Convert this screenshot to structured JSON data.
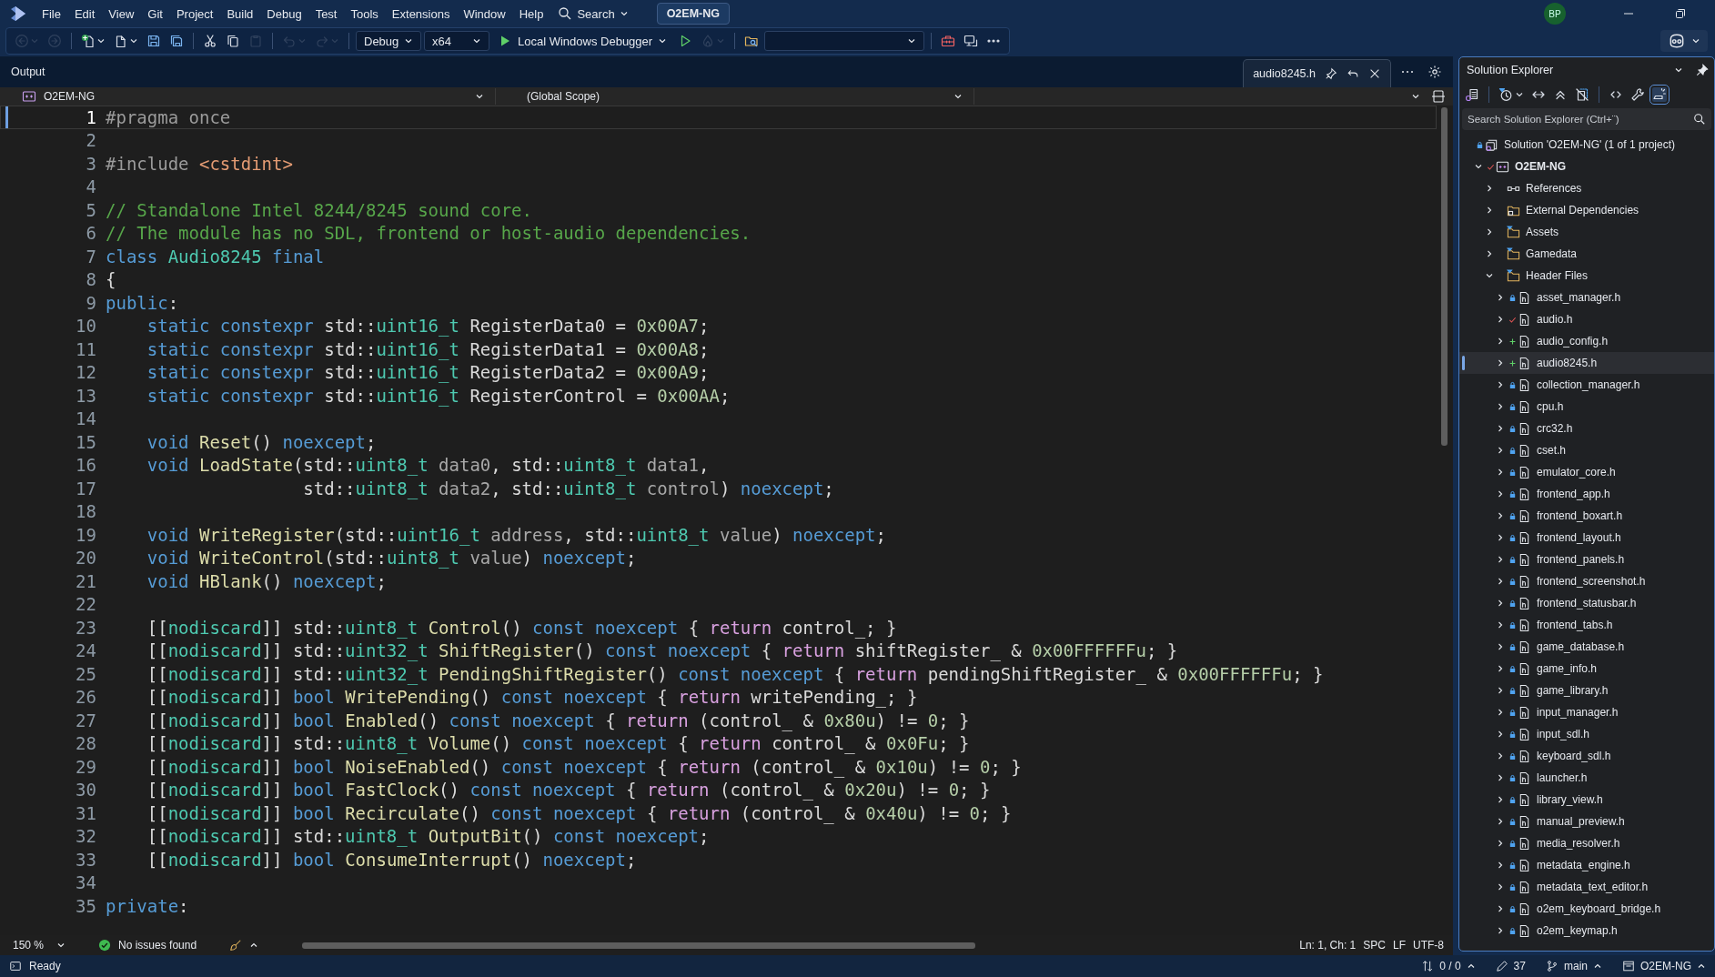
{
  "menu": [
    "File",
    "Edit",
    "View",
    "Git",
    "Project",
    "Build",
    "Debug",
    "Test",
    "Tools",
    "Extensions",
    "Window",
    "Help"
  ],
  "search": {
    "label": "Search"
  },
  "solution_badge": "O2EM-NG",
  "account": {
    "initials": "BP"
  },
  "toolbar": {
    "items": [
      {
        "kind": "back",
        "disabled": true,
        "dropdown": true
      },
      {
        "kind": "forward",
        "disabled": true,
        "dropdown": false
      },
      {
        "kind": "separator"
      },
      {
        "kind": "new_item",
        "disabled": false,
        "dropdown": true
      },
      {
        "kind": "open",
        "disabled": false,
        "dropdown": true
      },
      {
        "kind": "save",
        "disabled": false,
        "dropdown": false
      },
      {
        "kind": "save_all",
        "disabled": false,
        "dropdown": false
      },
      {
        "kind": "separator"
      },
      {
        "kind": "cut",
        "disabled": false,
        "dropdown": false
      },
      {
        "kind": "copy",
        "disabled": false,
        "dropdown": false
      },
      {
        "kind": "paste",
        "disabled": true,
        "dropdown": false
      },
      {
        "kind": "separator"
      },
      {
        "kind": "undo",
        "disabled": true,
        "dropdown": true
      },
      {
        "kind": "redo",
        "disabled": true,
        "dropdown": true
      },
      {
        "kind": "separator"
      },
      {
        "kind": "combo",
        "value": "Debug"
      },
      {
        "kind": "combo",
        "value": "x64"
      },
      {
        "kind": "debug_target",
        "label": "Local Windows Debugger"
      },
      {
        "kind": "start",
        "disabled": false,
        "dropdown": false
      },
      {
        "kind": "hot_reload",
        "disabled": true,
        "dropdown": true
      },
      {
        "kind": "separator"
      },
      {
        "kind": "find_in_files",
        "disabled": false,
        "dropdown": false
      },
      {
        "kind": "combo"
      },
      {
        "kind": "separator"
      },
      {
        "kind": "toolbox",
        "disabled": false,
        "dropdown": false
      },
      {
        "kind": "remote",
        "disabled": false,
        "dropdown": false
      },
      {
        "kind": "more",
        "disabled": false,
        "dropdown": false
      }
    ]
  },
  "document_well": {
    "tool_window": "Output",
    "tabs": [
      {
        "label": "audio8245.h",
        "selected": true
      }
    ]
  },
  "navigation_bar": {
    "project": "O2EM-NG",
    "scope": "(Global Scope)"
  },
  "editor": {
    "lines": [
      {
        "number": "1",
        "current": true,
        "tokens": [
          {
            "kind": "directive",
            "text": "#pragma once"
          }
        ]
      },
      {
        "number": "2",
        "current": false
      },
      {
        "number": "3",
        "current": false,
        "tokens": [
          {
            "kind": "directive",
            "text": "#include "
          },
          {
            "kind": "header",
            "text": "<cstdint>"
          }
        ]
      },
      {
        "number": "4",
        "current": false
      },
      {
        "number": "5",
        "current": false,
        "tokens": [
          {
            "kind": "comment",
            "text": "// Standalone Intel 8244/8245 sound core."
          }
        ]
      },
      {
        "number": "6",
        "current": false,
        "tokens": [
          {
            "kind": "comment",
            "text": "// The module has no SDL, frontend or host-audio dependencies."
          }
        ]
      },
      {
        "number": "7",
        "current": false,
        "tokens": [
          {
            "kind": "keyword",
            "text": "class "
          },
          {
            "kind": "type",
            "text": "Audio8245 "
          },
          {
            "kind": "keyword",
            "text": "final"
          }
        ]
      },
      {
        "number": "8",
        "current": false,
        "tokens": [
          {
            "kind": "plain",
            "text": "{"
          }
        ]
      },
      {
        "number": "9",
        "current": false,
        "tokens": [
          {
            "kind": "keyword",
            "text": "public"
          },
          {
            "kind": "plain",
            "text": ":"
          }
        ]
      },
      {
        "number": "10",
        "current": false,
        "tokens": [
          {
            "kind": "keyword",
            "text": "    static constexpr "
          },
          {
            "kind": "plain",
            "text": "std::"
          },
          {
            "kind": "type",
            "text": "uint16_t"
          },
          {
            "kind": "plain",
            "text": " RegisterData0 = "
          },
          {
            "kind": "number",
            "text": "0x00A7"
          },
          {
            "kind": "plain",
            "text": ";"
          }
        ]
      },
      {
        "number": "11",
        "current": false,
        "tokens": [
          {
            "kind": "keyword",
            "text": "    static constexpr "
          },
          {
            "kind": "plain",
            "text": "std::"
          },
          {
            "kind": "type",
            "text": "uint16_t"
          },
          {
            "kind": "plain",
            "text": " RegisterData1 = "
          },
          {
            "kind": "number",
            "text": "0x00A8"
          },
          {
            "kind": "plain",
            "text": ";"
          }
        ]
      },
      {
        "number": "12",
        "current": false,
        "tokens": [
          {
            "kind": "keyword",
            "text": "    static constexpr "
          },
          {
            "kind": "plain",
            "text": "std::"
          },
          {
            "kind": "type",
            "text": "uint16_t"
          },
          {
            "kind": "plain",
            "text": " RegisterData2 = "
          },
          {
            "kind": "number",
            "text": "0x00A9"
          },
          {
            "kind": "plain",
            "text": ";"
          }
        ]
      },
      {
        "number": "13",
        "current": false,
        "tokens": [
          {
            "kind": "keyword",
            "text": "    static constexpr "
          },
          {
            "kind": "plain",
            "text": "std::"
          },
          {
            "kind": "type",
            "text": "uint16_t"
          },
          {
            "kind": "plain",
            "text": " RegisterControl = "
          },
          {
            "kind": "number",
            "text": "0x00AA"
          },
          {
            "kind": "plain",
            "text": ";"
          }
        ]
      },
      {
        "number": "14",
        "current": false
      },
      {
        "number": "15",
        "current": false,
        "tokens": [
          {
            "kind": "keyword",
            "text": "    void "
          },
          {
            "kind": "function",
            "text": "Reset"
          },
          {
            "kind": "plain",
            "text": "() "
          },
          {
            "kind": "keyword",
            "text": "noexcept"
          },
          {
            "kind": "plain",
            "text": ";"
          }
        ]
      },
      {
        "number": "16",
        "current": false,
        "tokens": [
          {
            "kind": "keyword",
            "text": "    void "
          },
          {
            "kind": "function",
            "text": "LoadState"
          },
          {
            "kind": "plain",
            "text": "(std::"
          },
          {
            "kind": "type",
            "text": "uint8_t "
          },
          {
            "kind": "param",
            "text": "data0"
          },
          {
            "kind": "plain",
            "text": ", std::"
          },
          {
            "kind": "type",
            "text": "uint8_t "
          },
          {
            "kind": "param",
            "text": "data1"
          },
          {
            "kind": "plain",
            "text": ","
          }
        ]
      },
      {
        "number": "17",
        "current": false,
        "tokens": [
          {
            "kind": "plain",
            "text": "                   std::"
          },
          {
            "kind": "type",
            "text": "uint8_t "
          },
          {
            "kind": "param",
            "text": "data2"
          },
          {
            "kind": "plain",
            "text": ", std::"
          },
          {
            "kind": "type",
            "text": "uint8_t "
          },
          {
            "kind": "param",
            "text": "control"
          },
          {
            "kind": "plain",
            "text": ") "
          },
          {
            "kind": "keyword",
            "text": "noexcept"
          },
          {
            "kind": "plain",
            "text": ";"
          }
        ]
      },
      {
        "number": "18",
        "current": false
      },
      {
        "number": "19",
        "current": false,
        "tokens": [
          {
            "kind": "keyword",
            "text": "    void "
          },
          {
            "kind": "function",
            "text": "WriteRegister"
          },
          {
            "kind": "plain",
            "text": "(std::"
          },
          {
            "kind": "type",
            "text": "uint16_t "
          },
          {
            "kind": "param",
            "text": "address"
          },
          {
            "kind": "plain",
            "text": ", std::"
          },
          {
            "kind": "type",
            "text": "uint8_t "
          },
          {
            "kind": "param",
            "text": "value"
          },
          {
            "kind": "plain",
            "text": ") "
          },
          {
            "kind": "keyword",
            "text": "noexcept"
          },
          {
            "kind": "plain",
            "text": ";"
          }
        ]
      },
      {
        "number": "20",
        "current": false,
        "tokens": [
          {
            "kind": "keyword",
            "text": "    void "
          },
          {
            "kind": "function",
            "text": "WriteControl"
          },
          {
            "kind": "plain",
            "text": "(std::"
          },
          {
            "kind": "type",
            "text": "uint8_t "
          },
          {
            "kind": "param",
            "text": "value"
          },
          {
            "kind": "plain",
            "text": ") "
          },
          {
            "kind": "keyword",
            "text": "noexcept"
          },
          {
            "kind": "plain",
            "text": ";"
          }
        ]
      },
      {
        "number": "21",
        "current": false,
        "tokens": [
          {
            "kind": "keyword",
            "text": "    void "
          },
          {
            "kind": "function",
            "text": "HBlank"
          },
          {
            "kind": "plain",
            "text": "() "
          },
          {
            "kind": "keyword",
            "text": "noexcept"
          },
          {
            "kind": "plain",
            "text": ";"
          }
        ]
      },
      {
        "number": "22",
        "current": false
      },
      {
        "number": "23",
        "current": false,
        "tokens": [
          {
            "kind": "plain",
            "text": "    [["
          },
          {
            "kind": "type",
            "text": "nodiscard"
          },
          {
            "kind": "plain",
            "text": "]] std::"
          },
          {
            "kind": "type",
            "text": "uint8_t "
          },
          {
            "kind": "function",
            "text": "Control"
          },
          {
            "kind": "plain",
            "text": "() "
          },
          {
            "kind": "keyword",
            "text": "const noexcept"
          },
          {
            "kind": "plain",
            "text": " { "
          },
          {
            "kind": "control",
            "text": "return"
          },
          {
            "kind": "plain",
            "text": " control_; }"
          }
        ]
      },
      {
        "number": "24",
        "current": false,
        "tokens": [
          {
            "kind": "plain",
            "text": "    [["
          },
          {
            "kind": "type",
            "text": "nodiscard"
          },
          {
            "kind": "plain",
            "text": "]] std::"
          },
          {
            "kind": "type",
            "text": "uint32_t "
          },
          {
            "kind": "function",
            "text": "ShiftRegister"
          },
          {
            "kind": "plain",
            "text": "() "
          },
          {
            "kind": "keyword",
            "text": "const noexcept"
          },
          {
            "kind": "plain",
            "text": " { "
          },
          {
            "kind": "control",
            "text": "return"
          },
          {
            "kind": "plain",
            "text": " shiftRegister_ & "
          },
          {
            "kind": "number",
            "text": "0x00FFFFFFu"
          },
          {
            "kind": "plain",
            "text": "; }"
          }
        ]
      },
      {
        "number": "25",
        "current": false,
        "tokens": [
          {
            "kind": "plain",
            "text": "    [["
          },
          {
            "kind": "type",
            "text": "nodiscard"
          },
          {
            "kind": "plain",
            "text": "]] std::"
          },
          {
            "kind": "type",
            "text": "uint32_t "
          },
          {
            "kind": "function",
            "text": "PendingShiftRegister"
          },
          {
            "kind": "plain",
            "text": "() "
          },
          {
            "kind": "keyword",
            "text": "const noexcept"
          },
          {
            "kind": "plain",
            "text": " { "
          },
          {
            "kind": "control",
            "text": "return"
          },
          {
            "kind": "plain",
            "text": " pendingShiftRegister_ & "
          },
          {
            "kind": "number",
            "text": "0x00FFFFFFu"
          },
          {
            "kind": "plain",
            "text": "; }"
          }
        ]
      },
      {
        "number": "26",
        "current": false,
        "tokens": [
          {
            "kind": "plain",
            "text": "    [["
          },
          {
            "kind": "type",
            "text": "nodiscard"
          },
          {
            "kind": "plain",
            "text": "]] "
          },
          {
            "kind": "keyword",
            "text": "bool "
          },
          {
            "kind": "function",
            "text": "WritePending"
          },
          {
            "kind": "plain",
            "text": "() "
          },
          {
            "kind": "keyword",
            "text": "const noexcept"
          },
          {
            "kind": "plain",
            "text": " { "
          },
          {
            "kind": "control",
            "text": "return"
          },
          {
            "kind": "plain",
            "text": " writePending_; }"
          }
        ]
      },
      {
        "number": "27",
        "current": false,
        "tokens": [
          {
            "kind": "plain",
            "text": "    [["
          },
          {
            "kind": "type",
            "text": "nodiscard"
          },
          {
            "kind": "plain",
            "text": "]] "
          },
          {
            "kind": "keyword",
            "text": "bool "
          },
          {
            "kind": "function",
            "text": "Enabled"
          },
          {
            "kind": "plain",
            "text": "() "
          },
          {
            "kind": "keyword",
            "text": "const noexcept"
          },
          {
            "kind": "plain",
            "text": " { "
          },
          {
            "kind": "control",
            "text": "return"
          },
          {
            "kind": "plain",
            "text": " (control_ & "
          },
          {
            "kind": "number",
            "text": "0x80u"
          },
          {
            "kind": "plain",
            "text": ") != "
          },
          {
            "kind": "number",
            "text": "0"
          },
          {
            "kind": "plain",
            "text": "; }"
          }
        ]
      },
      {
        "number": "28",
        "current": false,
        "tokens": [
          {
            "kind": "plain",
            "text": "    [["
          },
          {
            "kind": "type",
            "text": "nodiscard"
          },
          {
            "kind": "plain",
            "text": "]] std::"
          },
          {
            "kind": "type",
            "text": "uint8_t "
          },
          {
            "kind": "function",
            "text": "Volume"
          },
          {
            "kind": "plain",
            "text": "() "
          },
          {
            "kind": "keyword",
            "text": "const noexcept"
          },
          {
            "kind": "plain",
            "text": " { "
          },
          {
            "kind": "control",
            "text": "return"
          },
          {
            "kind": "plain",
            "text": " control_ & "
          },
          {
            "kind": "number",
            "text": "0x0Fu"
          },
          {
            "kind": "plain",
            "text": "; }"
          }
        ]
      },
      {
        "number": "29",
        "current": false,
        "tokens": [
          {
            "kind": "plain",
            "text": "    [["
          },
          {
            "kind": "type",
            "text": "nodiscard"
          },
          {
            "kind": "plain",
            "text": "]] "
          },
          {
            "kind": "keyword",
            "text": "bool "
          },
          {
            "kind": "function",
            "text": "NoiseEnabled"
          },
          {
            "kind": "plain",
            "text": "() "
          },
          {
            "kind": "keyword",
            "text": "const noexcept"
          },
          {
            "kind": "plain",
            "text": " { "
          },
          {
            "kind": "control",
            "text": "return"
          },
          {
            "kind": "plain",
            "text": " (control_ & "
          },
          {
            "kind": "number",
            "text": "0x10u"
          },
          {
            "kind": "plain",
            "text": ") != "
          },
          {
            "kind": "number",
            "text": "0"
          },
          {
            "kind": "plain",
            "text": "; }"
          }
        ]
      },
      {
        "number": "30",
        "current": false,
        "tokens": [
          {
            "kind": "plain",
            "text": "    [["
          },
          {
            "kind": "type",
            "text": "nodiscard"
          },
          {
            "kind": "plain",
            "text": "]] "
          },
          {
            "kind": "keyword",
            "text": "bool "
          },
          {
            "kind": "function",
            "text": "FastClock"
          },
          {
            "kind": "plain",
            "text": "() "
          },
          {
            "kind": "keyword",
            "text": "const noexcept"
          },
          {
            "kind": "plain",
            "text": " { "
          },
          {
            "kind": "control",
            "text": "return"
          },
          {
            "kind": "plain",
            "text": " (control_ & "
          },
          {
            "kind": "number",
            "text": "0x20u"
          },
          {
            "kind": "plain",
            "text": ") != "
          },
          {
            "kind": "number",
            "text": "0"
          },
          {
            "kind": "plain",
            "text": "; }"
          }
        ]
      },
      {
        "number": "31",
        "current": false,
        "tokens": [
          {
            "kind": "plain",
            "text": "    [["
          },
          {
            "kind": "type",
            "text": "nodiscard"
          },
          {
            "kind": "plain",
            "text": "]] "
          },
          {
            "kind": "keyword",
            "text": "bool "
          },
          {
            "kind": "function",
            "text": "Recirculate"
          },
          {
            "kind": "plain",
            "text": "() "
          },
          {
            "kind": "keyword",
            "text": "const noexcept"
          },
          {
            "kind": "plain",
            "text": " { "
          },
          {
            "kind": "control",
            "text": "return"
          },
          {
            "kind": "plain",
            "text": " (control_ & "
          },
          {
            "kind": "number",
            "text": "0x40u"
          },
          {
            "kind": "plain",
            "text": ") != "
          },
          {
            "kind": "number",
            "text": "0"
          },
          {
            "kind": "plain",
            "text": "; }"
          }
        ]
      },
      {
        "number": "32",
        "current": false,
        "tokens": [
          {
            "kind": "plain",
            "text": "    [["
          },
          {
            "kind": "type",
            "text": "nodiscard"
          },
          {
            "kind": "plain",
            "text": "]] std::"
          },
          {
            "kind": "type",
            "text": "uint8_t "
          },
          {
            "kind": "function",
            "text": "OutputBit"
          },
          {
            "kind": "plain",
            "text": "() "
          },
          {
            "kind": "keyword",
            "text": "const noexcept"
          },
          {
            "kind": "plain",
            "text": ";"
          }
        ]
      },
      {
        "number": "33",
        "current": false,
        "tokens": [
          {
            "kind": "plain",
            "text": "    [["
          },
          {
            "kind": "type",
            "text": "nodiscard"
          },
          {
            "kind": "plain",
            "text": "]] "
          },
          {
            "kind": "keyword",
            "text": "bool "
          },
          {
            "kind": "function",
            "text": "ConsumeInterrupt"
          },
          {
            "kind": "plain",
            "text": "() "
          },
          {
            "kind": "keyword",
            "text": "noexcept"
          },
          {
            "kind": "plain",
            "text": ";"
          }
        ]
      },
      {
        "number": "34",
        "current": false
      },
      {
        "number": "35",
        "current": false,
        "tokens": [
          {
            "kind": "keyword",
            "text": "private"
          },
          {
            "kind": "plain",
            "text": ":"
          }
        ]
      }
    ]
  },
  "editor_footer": {
    "zoom": "150 %",
    "issues": "No issues found",
    "position": "Ln: 1, Ch: 1",
    "indentation": "SPC",
    "line_ending": "LF",
    "encoding": "UTF-8"
  },
  "solution_explorer": {
    "title": "Solution Explorer",
    "toolbar": [
      {
        "kind": "switch_views",
        "on": false,
        "dropdown": false
      },
      {
        "kind": "separator"
      },
      {
        "kind": "pending_filter",
        "on": false,
        "dropdown": true
      },
      {
        "kind": "sync",
        "on": false,
        "dropdown": false
      },
      {
        "kind": "collapse",
        "on": false,
        "dropdown": false
      },
      {
        "kind": "show_all",
        "on": false,
        "dropdown": false
      },
      {
        "kind": "separator"
      },
      {
        "kind": "view_code",
        "on": false,
        "dropdown": false
      },
      {
        "kind": "properties",
        "on": false,
        "dropdown": false
      },
      {
        "kind": "preview",
        "on": true,
        "dropdown": false
      }
    ],
    "search": {
      "placeholder": "Search Solution Explorer (Ctrl+¨)"
    },
    "tree": [
      {
        "kind": "solution",
        "label": "Solution 'O2EM-NG' (1 of 1 project)",
        "source_control": {
          "kind": "lock"
        },
        "selected": false,
        "children": [
          {
            "kind": "project",
            "label": "O2EM-NG",
            "source_control": {
              "kind": "checked_in"
            },
            "expanded": true,
            "selected": false,
            "children": [
              {
                "kind": "references",
                "label": "References",
                "expanded": false,
                "selected": false
              },
              {
                "kind": "dependencies",
                "label": "External Dependencies",
                "expanded": false,
                "selected": false
              },
              {
                "kind": "folder",
                "label": "Assets",
                "expanded": false,
                "selected": false
              },
              {
                "kind": "folder",
                "label": "Gamedata",
                "expanded": false,
                "selected": false
              },
              {
                "kind": "folder",
                "label": "Header Files",
                "expanded": true,
                "selected": false,
                "children": [
                  {
                    "kind": "header",
                    "label": "asset_manager.h",
                    "source_control": {
                      "kind": "lock"
                    },
                    "expanded": false,
                    "selected": false
                  },
                  {
                    "kind": "header",
                    "label": "audio.h",
                    "source_control": {
                      "kind": "checked_in"
                    },
                    "expanded": false,
                    "selected": false
                  },
                  {
                    "kind": "header",
                    "label": "audio_config.h",
                    "source_control": {
                      "kind": "added"
                    },
                    "expanded": false,
                    "selected": false
                  },
                  {
                    "kind": "header",
                    "label": "audio8245.h",
                    "source_control": {
                      "kind": "added"
                    },
                    "expanded": false,
                    "selected": true
                  },
                  {
                    "kind": "header",
                    "label": "collection_manager.h",
                    "source_control": {
                      "kind": "lock"
                    },
                    "expanded": false,
                    "selected": false
                  },
                  {
                    "kind": "header",
                    "label": "cpu.h",
                    "source_control": {
                      "kind": "lock"
                    },
                    "expanded": false,
                    "selected": false
                  },
                  {
                    "kind": "header",
                    "label": "crc32.h",
                    "source_control": {
                      "kind": "lock"
                    },
                    "expanded": false,
                    "selected": false
                  },
                  {
                    "kind": "header",
                    "label": "cset.h",
                    "source_control": {
                      "kind": "lock"
                    },
                    "expanded": false,
                    "selected": false
                  },
                  {
                    "kind": "header",
                    "label": "emulator_core.h",
                    "source_control": {
                      "kind": "lock"
                    },
                    "expanded": false,
                    "selected": false
                  },
                  {
                    "kind": "header",
                    "label": "frontend_app.h",
                    "source_control": {
                      "kind": "lock"
                    },
                    "expanded": false,
                    "selected": false
                  },
                  {
                    "kind": "header",
                    "label": "frontend_boxart.h",
                    "source_control": {
                      "kind": "lock"
                    },
                    "expanded": false,
                    "selected": false
                  },
                  {
                    "kind": "header",
                    "label": "frontend_layout.h",
                    "source_control": {
                      "kind": "lock"
                    },
                    "expanded": false,
                    "selected": false
                  },
                  {
                    "kind": "header",
                    "label": "frontend_panels.h",
                    "source_control": {
                      "kind": "lock"
                    },
                    "expanded": false,
                    "selected": false
                  },
                  {
                    "kind": "header",
                    "label": "frontend_screenshot.h",
                    "source_control": {
                      "kind": "lock"
                    },
                    "expanded": false,
                    "selected": false
                  },
                  {
                    "kind": "header",
                    "label": "frontend_statusbar.h",
                    "source_control": {
                      "kind": "lock"
                    },
                    "expanded": false,
                    "selected": false
                  },
                  {
                    "kind": "header",
                    "label": "frontend_tabs.h",
                    "source_control": {
                      "kind": "lock"
                    },
                    "expanded": false,
                    "selected": false
                  },
                  {
                    "kind": "header",
                    "label": "game_database.h",
                    "source_control": {
                      "kind": "lock"
                    },
                    "expanded": false,
                    "selected": false
                  },
                  {
                    "kind": "header",
                    "label": "game_info.h",
                    "source_control": {
                      "kind": "lock"
                    },
                    "expanded": false,
                    "selected": false
                  },
                  {
                    "kind": "header",
                    "label": "game_library.h",
                    "source_control": {
                      "kind": "lock"
                    },
                    "expanded": false,
                    "selected": false
                  },
                  {
                    "kind": "header",
                    "label": "input_manager.h",
                    "source_control": {
                      "kind": "lock"
                    },
                    "expanded": false,
                    "selected": false
                  },
                  {
                    "kind": "header",
                    "label": "input_sdl.h",
                    "source_control": {
                      "kind": "lock"
                    },
                    "expanded": false,
                    "selected": false
                  },
                  {
                    "kind": "header",
                    "label": "keyboard_sdl.h",
                    "source_control": {
                      "kind": "lock"
                    },
                    "expanded": false,
                    "selected": false
                  },
                  {
                    "kind": "header",
                    "label": "launcher.h",
                    "source_control": {
                      "kind": "lock"
                    },
                    "expanded": false,
                    "selected": false
                  },
                  {
                    "kind": "header",
                    "label": "library_view.h",
                    "source_control": {
                      "kind": "lock"
                    },
                    "expanded": false,
                    "selected": false
                  },
                  {
                    "kind": "header",
                    "label": "manual_preview.h",
                    "source_control": {
                      "kind": "lock"
                    },
                    "expanded": false,
                    "selected": false
                  },
                  {
                    "kind": "header",
                    "label": "media_resolver.h",
                    "source_control": {
                      "kind": "lock"
                    },
                    "expanded": false,
                    "selected": false
                  },
                  {
                    "kind": "header",
                    "label": "metadata_engine.h",
                    "source_control": {
                      "kind": "lock"
                    },
                    "expanded": false,
                    "selected": false
                  },
                  {
                    "kind": "header",
                    "label": "metadata_text_editor.h",
                    "source_control": {
                      "kind": "lock"
                    },
                    "expanded": false,
                    "selected": false
                  },
                  {
                    "kind": "header",
                    "label": "o2em_keyboard_bridge.h",
                    "source_control": {
                      "kind": "lock"
                    },
                    "expanded": false,
                    "selected": false
                  },
                  {
                    "kind": "header",
                    "label": "o2em_keymap.h",
                    "source_control": {
                      "kind": "lock"
                    },
                    "expanded": false,
                    "selected": false
                  }
                ]
              }
            ]
          }
        ]
      }
    ]
  },
  "status_bar": {
    "message": "Ready",
    "changes": "0 / 0",
    "edits": "37",
    "branch": "main",
    "repository": "O2EM-NG"
  }
}
